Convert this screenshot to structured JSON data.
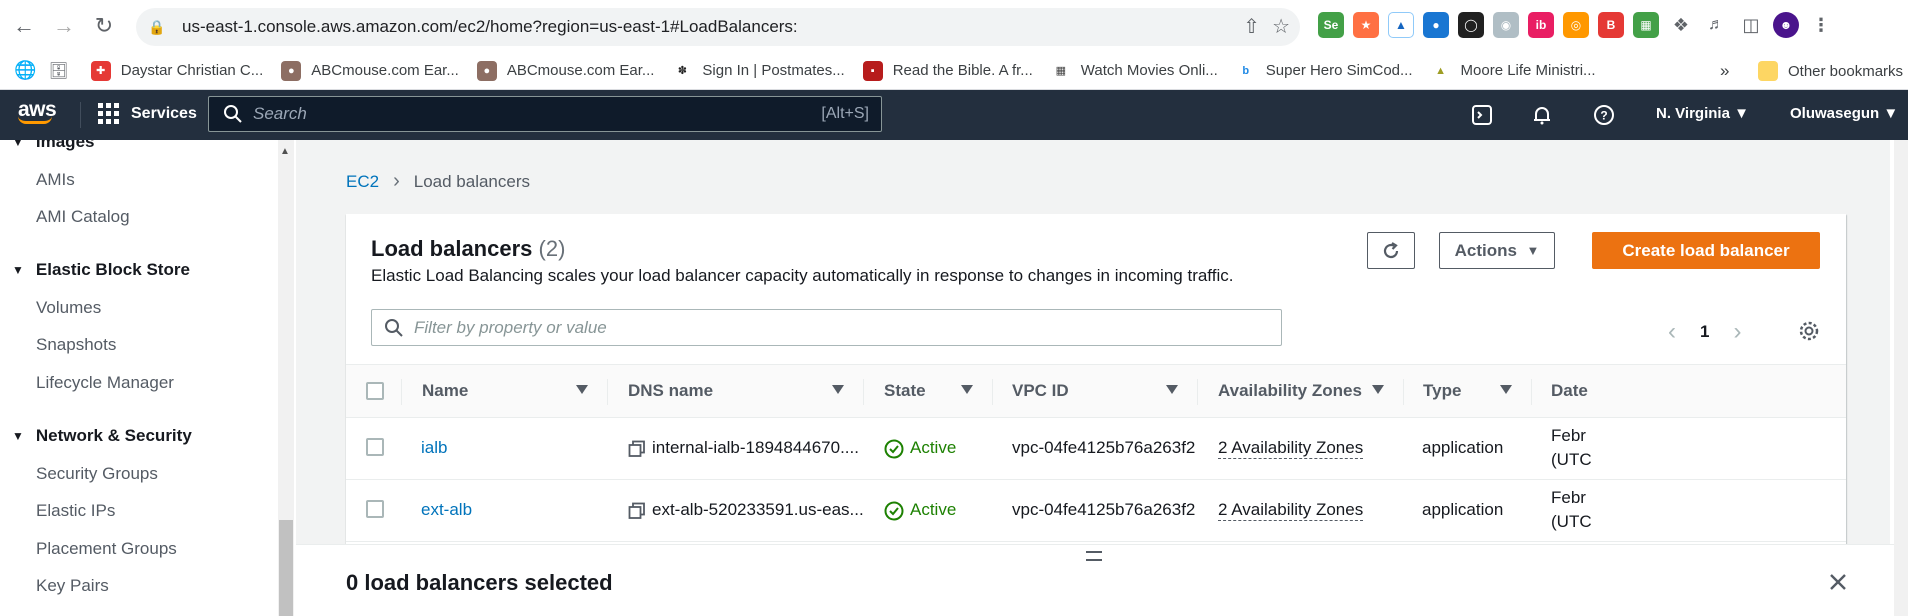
{
  "browser": {
    "url": "us-east-1.console.aws.amazon.com/ec2/home?region=us-east-1#LoadBalancers:",
    "bookmarks": [
      {
        "label": "Daystar Christian C...",
        "color": "#e53935"
      },
      {
        "label": "ABCmouse.com Ear...",
        "color": "#8d6e63"
      },
      {
        "label": "ABCmouse.com Ear...",
        "color": "#8d6e63"
      },
      {
        "label": "Sign In | Postmates...",
        "color": "#212121"
      },
      {
        "label": "Read the Bible. A fr...",
        "color": "#b71c1c"
      },
      {
        "label": "Watch Movies Onli...",
        "color": "#424242"
      },
      {
        "label": "Super Hero SimCod...",
        "color": "#1e88e5"
      },
      {
        "label": "Moore Life Ministri...",
        "color": "#9e9d24"
      }
    ],
    "more_bookmarks": "»",
    "other_bookmarks": "Other bookmarks"
  },
  "aws_header": {
    "logo": "aws",
    "services": "Services",
    "search_placeholder": "Search",
    "search_shortcut": "[Alt+S]",
    "region": "N. Virginia",
    "user": "Oluwasegun"
  },
  "sidebar": {
    "groups": [
      {
        "label": "Images",
        "items": [
          "AMIs",
          "AMI Catalog"
        ]
      },
      {
        "label": "Elastic Block Store",
        "items": [
          "Volumes",
          "Snapshots",
          "Lifecycle Manager"
        ]
      },
      {
        "label": "Network & Security",
        "items": [
          "Security Groups",
          "Elastic IPs",
          "Placement Groups",
          "Key Pairs"
        ]
      }
    ]
  },
  "breadcrumb": {
    "root": "EC2",
    "current": "Load balancers"
  },
  "panel": {
    "title": "Load balancers",
    "count": "(2)",
    "description": "Elastic Load Balancing scales your load balancer capacity automatically in response to changes in incoming traffic.",
    "actions_label": "Actions",
    "create_label": "Create load balancer",
    "filter_placeholder": "Filter by property or value",
    "page": "1"
  },
  "table": {
    "columns": [
      "Name",
      "DNS name",
      "State",
      "VPC ID",
      "Availability Zones",
      "Type",
      "Date"
    ],
    "column_partial": "Date",
    "rows": [
      {
        "name": "ialb",
        "dns": "internal-ialb-1894844670....",
        "state": "Active",
        "vpc": "vpc-04fe4125b76a263f2",
        "az": "2 Availability Zones",
        "type": "application",
        "date1": "Febr",
        "date2": "(UTC"
      },
      {
        "name": "ext-alb",
        "dns": "ext-alb-520233591.us-eas...",
        "state": "Active",
        "vpc": "vpc-04fe4125b76a263f2",
        "az": "2 Availability Zones",
        "type": "application",
        "date1": "Febr",
        "date2": "(UTC"
      }
    ]
  },
  "split_panel": {
    "title": "0 load balancers selected"
  },
  "colors": {
    "aws_nav": "#232f3e",
    "primary": "#ec7211",
    "link": "#0073bb",
    "success": "#1d8102"
  }
}
